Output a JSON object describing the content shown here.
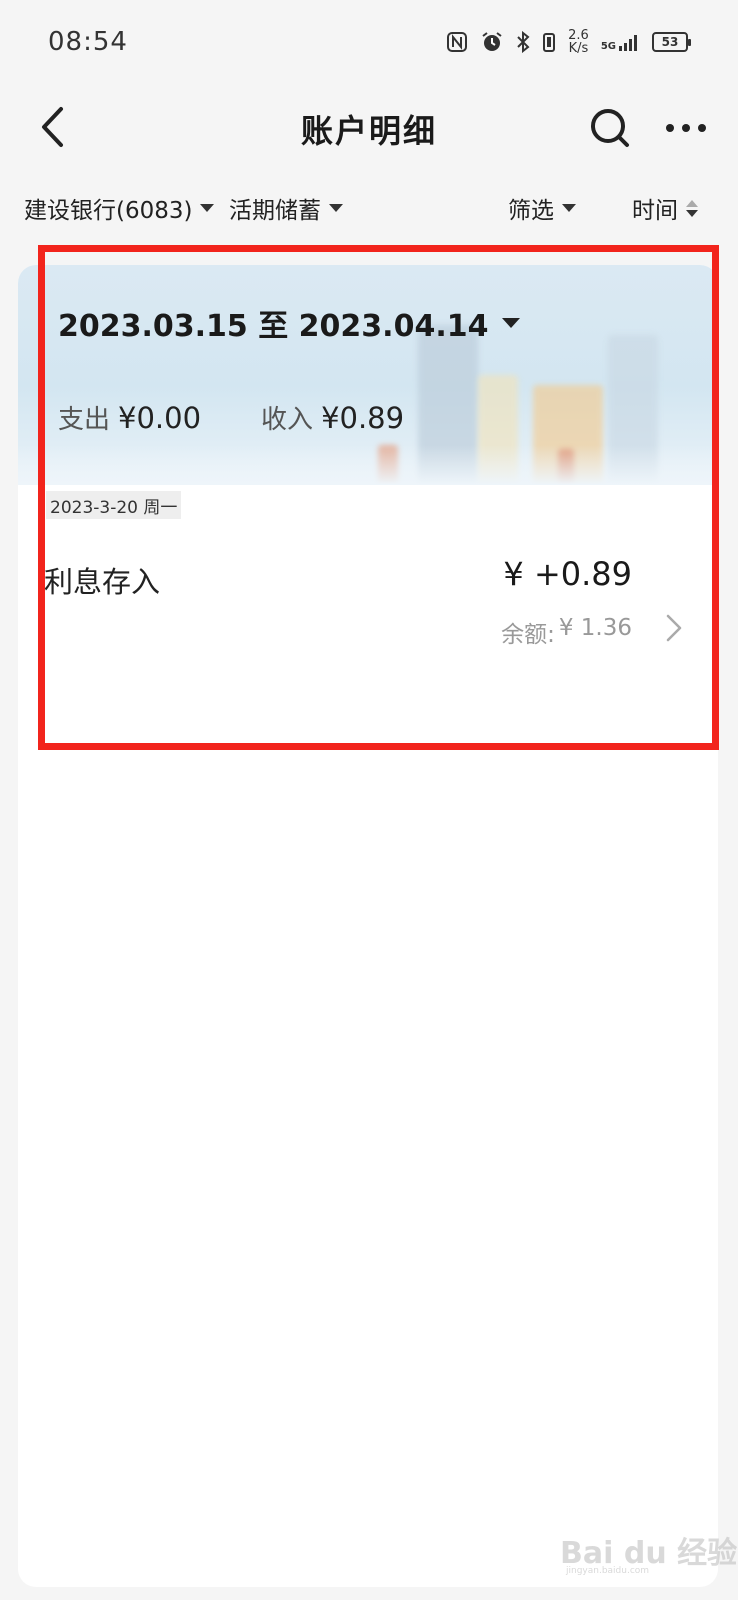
{
  "status_bar": {
    "time": "08:54",
    "speed_value": "2.6",
    "speed_unit": "K/s",
    "network": "5G",
    "battery": "53",
    "icons": [
      "nfc-icon",
      "alarm-icon",
      "bluetooth-icon",
      "vibrate-icon",
      "signal-icon",
      "battery-icon"
    ]
  },
  "header": {
    "title": "账户明细",
    "back_icon": "chevron-left-icon",
    "search_icon": "search-icon",
    "more_icon": "more-horizontal-icon"
  },
  "filters": {
    "account": "建设银行(6083)",
    "account_type": "活期储蓄",
    "filter": "筛选",
    "sort": "时间"
  },
  "summary": {
    "date_range": "2023.03.15 至 2023.04.14",
    "expense_label": "支出",
    "expense_value": "¥0.00",
    "income_label": "收入",
    "income_value": "¥0.89"
  },
  "transactions": [
    {
      "day_header": "2023-3-20 周一",
      "description": "利息存入",
      "amount": "¥ +0.89",
      "balance_label": "余额:",
      "balance_value": "¥ 1.36"
    }
  ],
  "watermark": {
    "text": "Bai du 经验",
    "sub": "jingyan.baidu.com"
  },
  "colors": {
    "highlight": "#f2241c",
    "background": "#f5f5f5",
    "card": "#ffffff",
    "muted_text": "#999999"
  }
}
